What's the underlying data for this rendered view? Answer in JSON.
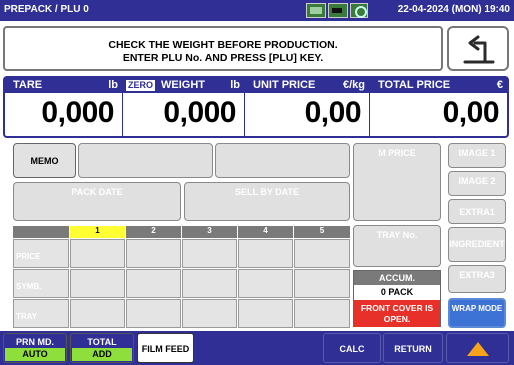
{
  "topbar": {
    "title": "PREPACK / PLU 0",
    "datetime": "22-04-2024 (MON) 19:40",
    "icons": [
      "screen-icon",
      "battery-icon",
      "network-icon"
    ]
  },
  "message": {
    "line1": "CHECK THE WEIGHT BEFORE PRODUCTION.",
    "line2": "ENTER PLU No. AND PRESS [PLU] KEY."
  },
  "display": {
    "tare": {
      "label": "TARE",
      "unit": "lb",
      "value": "0,000"
    },
    "weight": {
      "badge": "ZERO",
      "label": "WEIGHT",
      "unit": "lb",
      "value": "0,000"
    },
    "unit_price": {
      "label": "UNIT PRICE",
      "unit": "€/kg",
      "value": "0,00"
    },
    "total_price": {
      "label": "TOTAL PRICE",
      "unit": "€",
      "value": "0,00"
    }
  },
  "buttons": {
    "memo": "MEMO",
    "m_price": "M PRICE",
    "pack_date": "PACK DATE",
    "sell_by_date": "SELL BY DATE",
    "tray_no": "TRAY No.",
    "image1": "IMAGE 1",
    "image2": "IMAGE 2",
    "extra1": "EXTRA1",
    "ingredient": "INGREDIENT",
    "extra3": "EXTRA3",
    "wrap_mode": "WRAP MODE"
  },
  "grid": {
    "columns": [
      "1",
      "2",
      "3",
      "4",
      "5"
    ],
    "active_column": "1",
    "rows": [
      "PRICE",
      "SYMB.",
      "TRAY"
    ]
  },
  "accum": {
    "label": "ACCUM.",
    "count": "0 PACK",
    "warning": "FRONT COVER IS OPEN."
  },
  "bottom": {
    "prn_md": {
      "top": "PRN MD.",
      "bottom": "AUTO"
    },
    "total": {
      "top": "TOTAL",
      "bottom": "ADD"
    },
    "film_feed": "FILM FEED",
    "calc": "CALC",
    "return": "RETURN",
    "up_icon": "up-arrow-icon"
  },
  "colors": {
    "header_blue": "#2f2f96",
    "active_yellow": "#ffff33",
    "warning_red": "#e8302a",
    "auto_green": "#8ede3c",
    "wrap_blue": "#3e73d6",
    "up_arrow_orange": "#f5a31a"
  }
}
